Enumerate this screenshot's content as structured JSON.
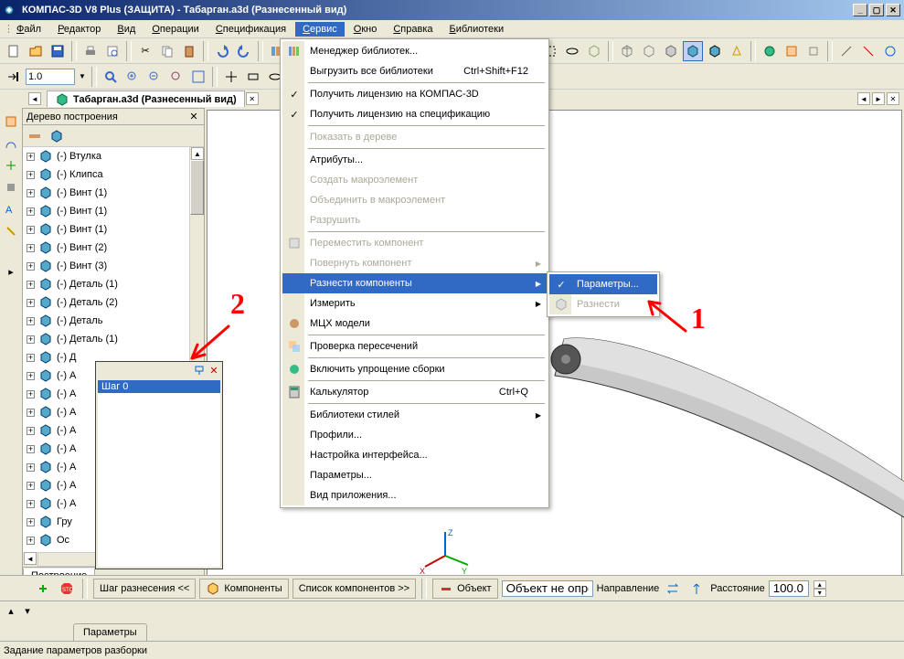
{
  "title": "КОМПАС-3D V8 Plus (ЗАЩИТА) - Табарган.a3d (Разнесенный вид)",
  "menubar": [
    "Файл",
    "Редактор",
    "Вид",
    "Операции",
    "Спецификация",
    "Сервис",
    "Окно",
    "Справка",
    "Библиотеки"
  ],
  "open_menu_index": 5,
  "doc_tab": "Табарган.a3d (Разнесенный вид)",
  "tree_title": "Дерево построения",
  "tree_items": [
    "(-) Втулка",
    "(-) Клипса",
    "(-) Винт (1)",
    "(-) Винт (1)",
    "(-) Винт (1)",
    "(-) Винт (2)",
    "(-) Винт (3)",
    "(-) Деталь (1)",
    "(-) Деталь (2)",
    "(-) Деталь",
    "(-) Деталь (1)",
    "(-) Д",
    "(-) А",
    "(-) А",
    "(-) А",
    "(-) А",
    "(-) А",
    "(-) А",
    "(-) А",
    "(-) А",
    "Гру",
    "Ос"
  ],
  "tree_bottom_tab": "Построение",
  "popup_item": "Шаг 0",
  "scale_value": "1.0",
  "service_menu": {
    "lib_manager": "Менеджер библиотек...",
    "unload_all": "Выгрузить все библиотеки",
    "unload_shortcut": "Ctrl+Shift+F12",
    "get_license": "Получить лицензию на КОМПАС-3D",
    "get_spec": "Получить лицензию на спецификацию",
    "show_tree": "Показать в дереве",
    "attributes": "Атрибуты...",
    "create_macro": "Создать макроэлемент",
    "join_macro": "Объединить в макроэлемент",
    "destroy": "Разрушить",
    "move_comp": "Переместить компонент",
    "rotate_comp": "Повернуть компонент",
    "explode": "Разнести компоненты",
    "measure": "Измерить",
    "mcx": "МЦХ модели",
    "intersect": "Проверка пересечений",
    "simplify": "Включить упрощение сборки",
    "calc": "Калькулятор",
    "calc_shortcut": "Ctrl+Q",
    "style_libs": "Библиотеки стилей",
    "profiles": "Профили...",
    "ui_setup": "Настройка интерфейса...",
    "params": "Параметры...",
    "app_view": "Вид приложения..."
  },
  "submenu": {
    "params": "Параметры...",
    "explode": "Разнести"
  },
  "param_bar": {
    "step": "Шаг разнесения  <<",
    "components": "Компоненты",
    "comp_list": "Список компонентов  >>",
    "object": "Объект",
    "obj_status": "Объект не опреде",
    "direction": "Направление",
    "distance": "Расстояние",
    "distance_val": "100.0"
  },
  "param_tab": "Параметры",
  "statusbar": "Задание параметров разборки",
  "annotations": {
    "a1": "1",
    "a2": "2"
  }
}
